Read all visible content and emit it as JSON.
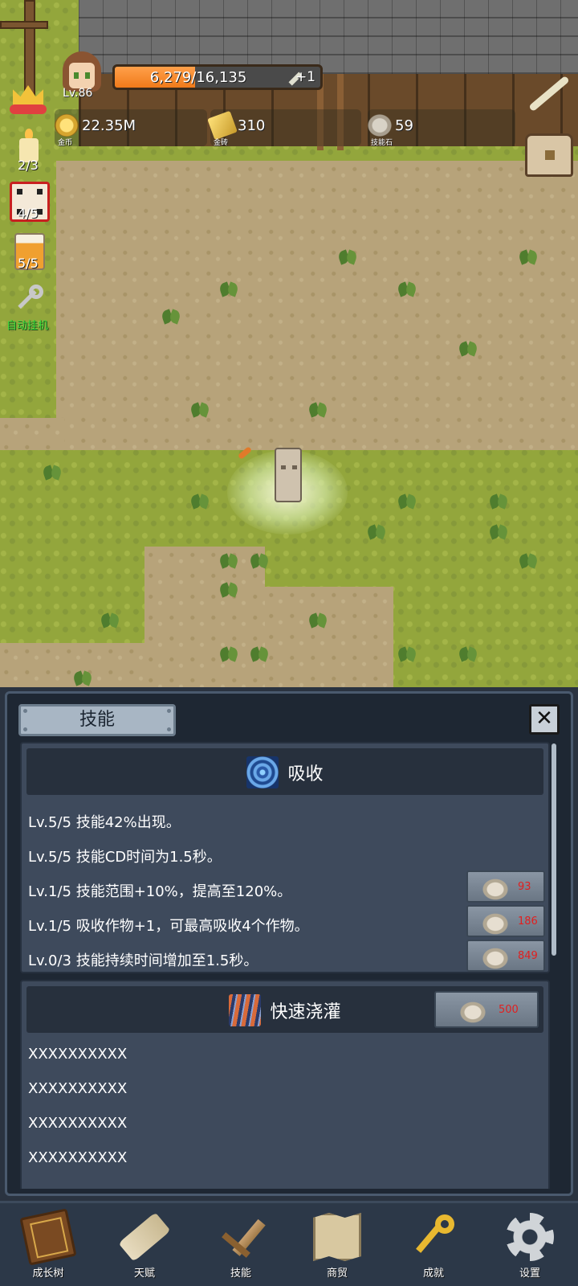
{
  "player": {
    "level": "Lv.86"
  },
  "xp": {
    "text": "6,279/16,135",
    "fraction": 0.389,
    "bonus": "+1"
  },
  "resources": [
    {
      "icon": "coin-icon",
      "value": "22.35M",
      "caption": "金币"
    },
    {
      "icon": "gold-bar-icon",
      "value": "310",
      "caption": "金砖"
    },
    {
      "icon": "skill-stone-icon",
      "value": "59",
      "caption": "技能石"
    }
  ],
  "side": {
    "candle_count": "2/3",
    "dice_count": "4/5",
    "beer_count": "5/5",
    "auto_label": "自动挂机"
  },
  "panel": {
    "title": "技能",
    "close": "✕",
    "skills": [
      {
        "name": "吸收",
        "icon": "vortex-icon",
        "lines": [
          {
            "text": "Lv.5/5 技能42%出现。",
            "cost": ""
          },
          {
            "text": "Lv.5/5 技能CD时间为1.5秒。",
            "cost": ""
          },
          {
            "text": "Lv.1/5 技能范围+10%，提高至120%。",
            "cost": "93"
          },
          {
            "text": "Lv.1/5 吸收作物+1，可最高吸收4个作物。",
            "cost": "186"
          },
          {
            "text": "Lv.0/3 技能持续时间增加至1.5秒。",
            "cost": "849"
          }
        ]
      },
      {
        "name": "快速浇灌",
        "icon": "rain-icon",
        "unlock_cost": "500",
        "lines": [
          {
            "text": "XXXXXXXXXX"
          },
          {
            "text": "XXXXXXXXXX"
          },
          {
            "text": "XXXXXXXXXX"
          },
          {
            "text": "XXXXXXXXXX"
          }
        ]
      }
    ]
  },
  "nav": [
    {
      "label": "成长树",
      "icon": "book-icon"
    },
    {
      "label": "天赋",
      "icon": "scroll-icon"
    },
    {
      "label": "技能",
      "icon": "sword-icon"
    },
    {
      "label": "商贸",
      "icon": "map-icon"
    },
    {
      "label": "成就",
      "icon": "key-icon"
    },
    {
      "label": "设置",
      "icon": "gear-icon"
    }
  ],
  "colors": {
    "xp_fill": "#f07a1a",
    "cost_text": "#e02020",
    "auto_label": "#3cdc3c",
    "panel_bg": "#1e2733"
  }
}
